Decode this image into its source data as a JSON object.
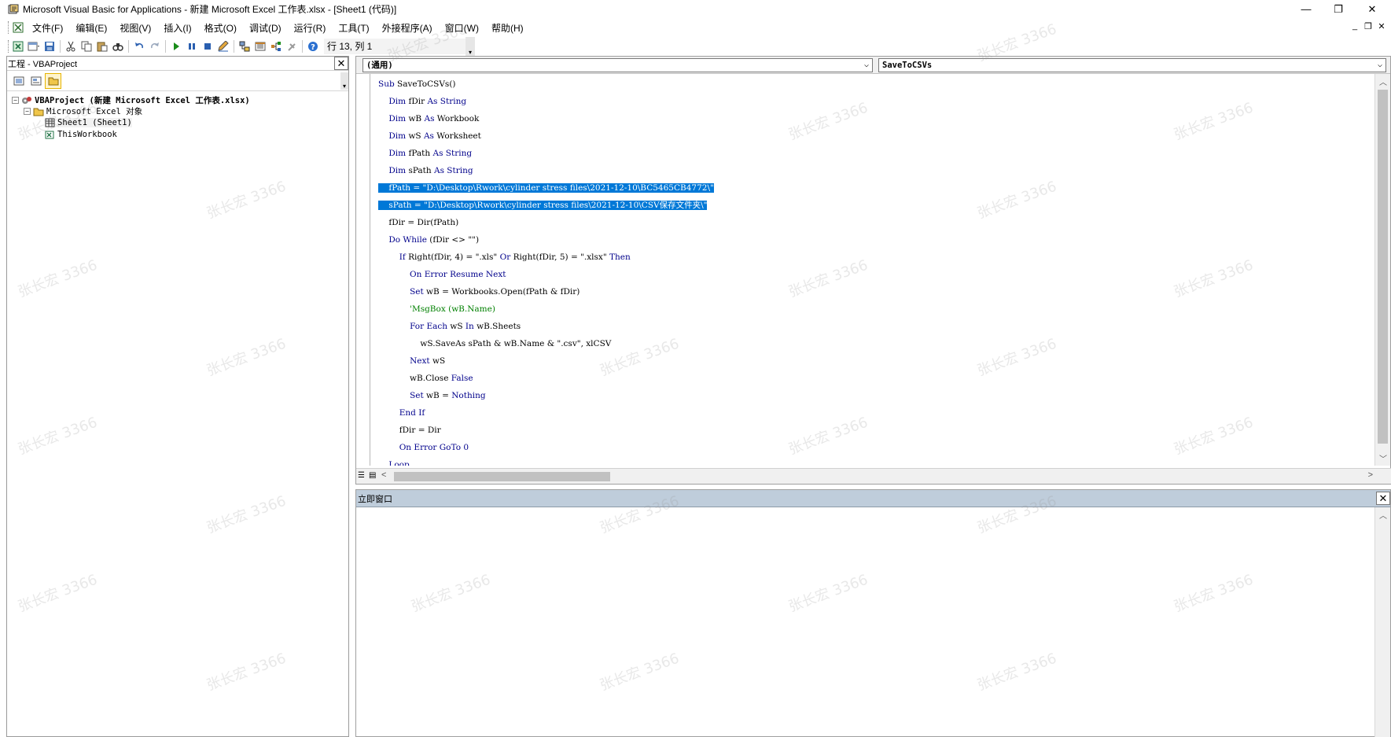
{
  "window": {
    "title": "Microsoft Visual Basic for Applications - 新建 Microsoft Excel 工作表.xlsx - [Sheet1 (代码)]",
    "controls": [
      "—",
      "❐",
      "✕"
    ]
  },
  "menu": {
    "items": [
      "文件(F)",
      "编辑(E)",
      "视图(V)",
      "插入(I)",
      "格式(O)",
      "调试(D)",
      "运行(R)",
      "工具(T)",
      "外接程序(A)",
      "窗口(W)",
      "帮助(H)"
    ],
    "mdi_controls": [
      "_",
      "❐",
      "✕"
    ]
  },
  "toolbar": {
    "status": "行 13, 列 1",
    "icons": [
      "view-excel-icon",
      "insert-userform-icon",
      "save-icon",
      "cut-icon",
      "copy-icon",
      "paste-icon",
      "find-icon",
      "undo-icon",
      "redo-icon",
      "run-icon",
      "break-icon",
      "reset-icon",
      "design-mode-icon",
      "project-explorer-icon",
      "properties-icon",
      "object-browser-icon",
      "toolbox-icon",
      "help-icon"
    ]
  },
  "project": {
    "title": "工程 - VBAProject",
    "close": "✕",
    "tree": [
      {
        "label": "VBAProject (新建 Microsoft Excel 工作表.xlsx)",
        "toggle": "−",
        "bold": true
      },
      {
        "label": "Microsoft Excel 对象",
        "toggle": "−"
      },
      {
        "label": "Sheet1 (Sheet1)"
      },
      {
        "label": "ThisWorkbook"
      }
    ]
  },
  "code": {
    "object_combo": "(通用)",
    "proc_combo": "SaveToCSVs",
    "lines": [
      "Sub SaveToCSVs()",
      "    Dim fDir As String",
      "    Dim wB As Workbook",
      "    Dim wS As Worksheet",
      "    Dim fPath As String",
      "    Dim sPath As String",
      "    fPath = \"D:\\Desktop\\Rwork\\cylinder stress files\\2021-12-10\\BC5465CB4772\\\"",
      "    sPath = \"D:\\Desktop\\Rwork\\cylinder stress files\\2021-12-10\\CSV保存文件夹\\\"",
      "    fDir = Dir(fPath)",
      "    Do While (fDir <> \"\")",
      "        If Right(fDir, 4) = \".xls\" Or Right(fDir, 5) = \".xlsx\" Then",
      "            On Error Resume Next",
      "            Set wB = Workbooks.Open(fPath & fDir)",
      "            'MsgBox (wB.Name)",
      "            For Each wS In wB.Sheets",
      "                wS.SaveAs sPath & wB.Name & \".csv\", xlCSV",
      "            Next wS",
      "            wB.Close False",
      "            Set wB = Nothing",
      "        End If",
      "        fDir = Dir",
      "        On Error GoTo 0",
      "    Loop"
    ]
  },
  "immediate": {
    "title": "立即窗口",
    "close": "✕"
  },
  "watermark": "张长宏 3366"
}
